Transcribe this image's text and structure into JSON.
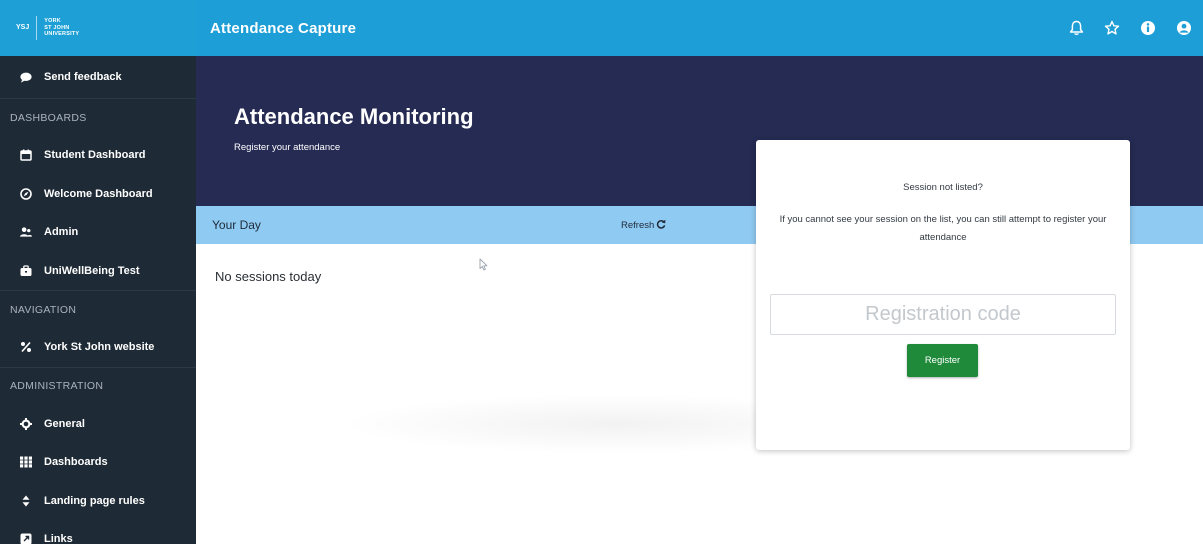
{
  "brand": {
    "mark": "YSJ",
    "text_lines": [
      "YORK",
      "ST JOHN",
      "UNIVERSITY"
    ]
  },
  "app": {
    "title": "Attendance Capture"
  },
  "sidebar": {
    "feedback": {
      "label": "Send feedback",
      "icon": "chat-bubble-icon"
    },
    "sections": [
      {
        "title": "DASHBOARDS",
        "items": [
          {
            "label": "Student Dashboard",
            "icon": "calendar-icon"
          },
          {
            "label": "Welcome Dashboard",
            "icon": "compass-icon"
          },
          {
            "label": "Admin",
            "icon": "users-icon"
          },
          {
            "label": "UniWellBeing Test",
            "icon": "briefcase-icon"
          }
        ]
      },
      {
        "title": "NAVIGATION",
        "items": [
          {
            "label": "York St John website",
            "icon": "percent-link-icon"
          }
        ]
      },
      {
        "title": "ADMINISTRATION",
        "items": [
          {
            "label": "General",
            "icon": "gear-icon"
          },
          {
            "label": "Dashboards",
            "icon": "grid-icon"
          },
          {
            "label": "Landing page rules",
            "icon": "sort-icon"
          },
          {
            "label": "Links",
            "icon": "external-link-icon"
          }
        ]
      }
    ]
  },
  "topbar": {
    "icons": [
      "bell-icon",
      "star-icon",
      "info-icon",
      "user-icon"
    ]
  },
  "hero": {
    "title": "Attendance Monitoring",
    "subtitle": "Register your attendance"
  },
  "day": {
    "label": "Your Day",
    "refresh_label": "Refresh",
    "empty_text": "No sessions today"
  },
  "card": {
    "title": "Session not listed?",
    "text": "If you cannot see your session on the list, you can still attempt to register your attendance",
    "input_placeholder": "Registration code",
    "button_label": "Register"
  },
  "colors": {
    "sidebar_bg": "#1e2a35",
    "topbar_bg": "#1e9ed6",
    "hero_bg": "#252b53",
    "day_strip_bg": "#8fcaf2",
    "register_button": "#1e8a3a"
  }
}
